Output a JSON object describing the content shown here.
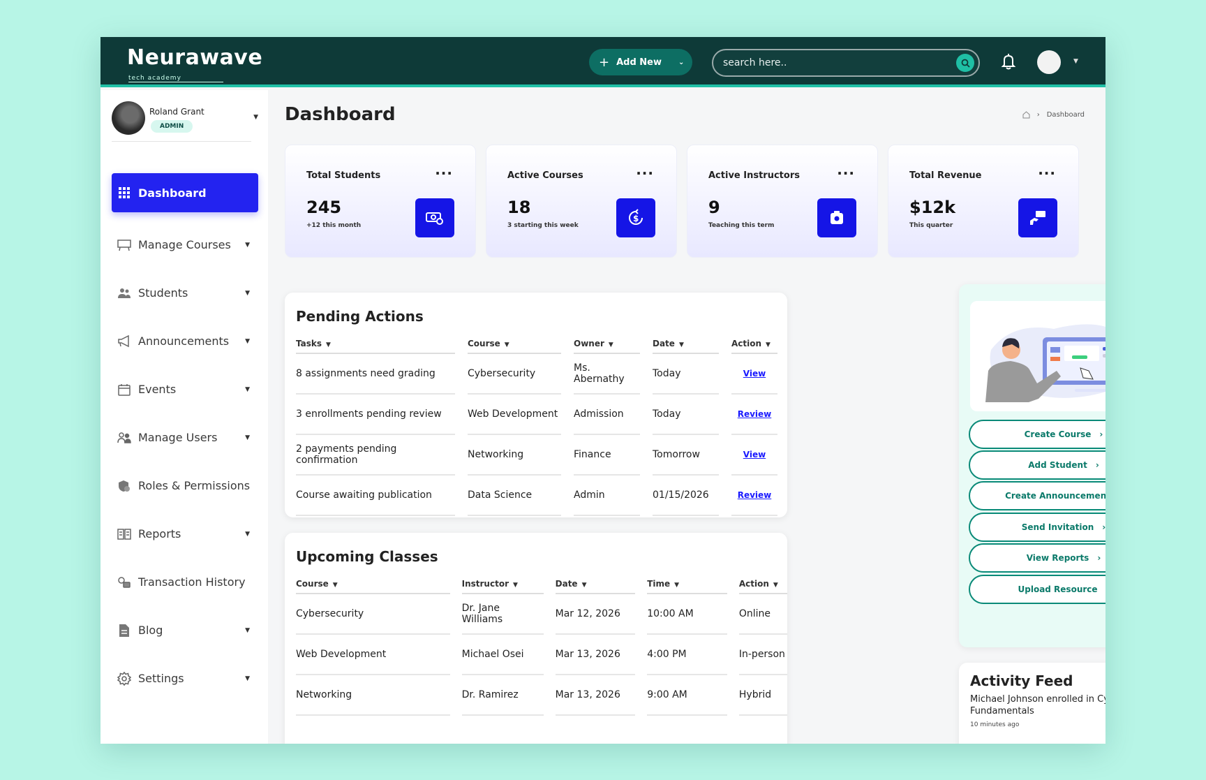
{
  "app": {
    "logo_text": "Neurawave",
    "logo_sub": "tech academy"
  },
  "topbar": {
    "add_new_label": "Add New",
    "search_placeholder": "search here.."
  },
  "user": {
    "name": "Roland Grant",
    "role": "ADMIN"
  },
  "sidebar": {
    "items": [
      {
        "label": "Dashboard",
        "icon": "grid-icon"
      },
      {
        "label": "Manage Courses",
        "icon": "courses-icon"
      },
      {
        "label": "Students",
        "icon": "students-icon"
      },
      {
        "label": "Announcements",
        "icon": "megaphone-icon"
      },
      {
        "label": "Events",
        "icon": "calendar-icon"
      },
      {
        "label": "Manage Users",
        "icon": "users-icon"
      },
      {
        "label": "Roles & Permissions",
        "icon": "shield-icon"
      },
      {
        "label": "Reports",
        "icon": "reports-icon"
      },
      {
        "label": "Transaction History",
        "icon": "transaction-icon"
      },
      {
        "label": "Blog",
        "icon": "document-icon"
      },
      {
        "label": "Settings",
        "icon": "gear-icon"
      }
    ]
  },
  "page": {
    "title": "Dashboard",
    "breadcrumb_current": "Dashboard"
  },
  "stats": [
    {
      "label": "Total Students",
      "value": "245",
      "sub": "+12 this month",
      "icon": "money-icon"
    },
    {
      "label": "Active Courses",
      "value": "18",
      "sub": "3 starting this week",
      "icon": "dollar-cycle-icon"
    },
    {
      "label": "Active Instructors",
      "value": "9",
      "sub": "Teaching this term",
      "icon": "camera-icon"
    },
    {
      "label": "Total Revenue",
      "value": "$12k",
      "sub": "This quarter",
      "icon": "hand-money-icon"
    }
  ],
  "pending": {
    "title": "Pending Actions",
    "headers": [
      "Tasks",
      "Course",
      "Owner",
      "Date",
      "Action"
    ],
    "rows": [
      {
        "task": "8 assignments need grading",
        "course": "Cybersecurity",
        "owner": "Ms. Abernathy",
        "date": "Today",
        "action": "View"
      },
      {
        "task": "3 enrollments pending review",
        "course": "Web Development",
        "owner": "Admission",
        "date": "Today",
        "action": "Review"
      },
      {
        "task": "2 payments pending confirmation",
        "course": "Networking",
        "owner": "Finance",
        "date": "Tomorrow",
        "action": "View"
      },
      {
        "task": "Course awaiting publication",
        "course": "Data Science",
        "owner": "Admin",
        "date": "01/15/2026",
        "action": "Review"
      }
    ]
  },
  "classes": {
    "title": "Upcoming Classes",
    "headers": [
      "Course",
      "Instructor",
      "Date",
      "Time",
      "Action"
    ],
    "rows": [
      {
        "course": "Cybersecurity",
        "instructor": "Dr. Jane Williams",
        "date": "Mar 12, 2026",
        "time": "10:00 AM",
        "action": "Online"
      },
      {
        "course": "Web Development",
        "instructor": "Michael Osei",
        "date": "Mar 13, 2026",
        "time": "4:00 PM",
        "action": "In-person"
      },
      {
        "course": "Networking",
        "instructor": "Dr. Ramirez",
        "date": "Mar 13, 2026",
        "time": "9:00 AM",
        "action": "Hybrid"
      }
    ]
  },
  "quick_actions": [
    "Create Course",
    "Add Student",
    "Create Announcement",
    "Send Invitation",
    "View Reports",
    "Upload Resource"
  ],
  "activity": {
    "title": "Activity Feed",
    "message": "Michael Johnson enrolled in Cybersecurity Fundamentals",
    "time": "10 minutes ago"
  },
  "colors": {
    "accent": "#2323f0",
    "topbar": "#0e3a38",
    "teal": "#0a8a78"
  }
}
